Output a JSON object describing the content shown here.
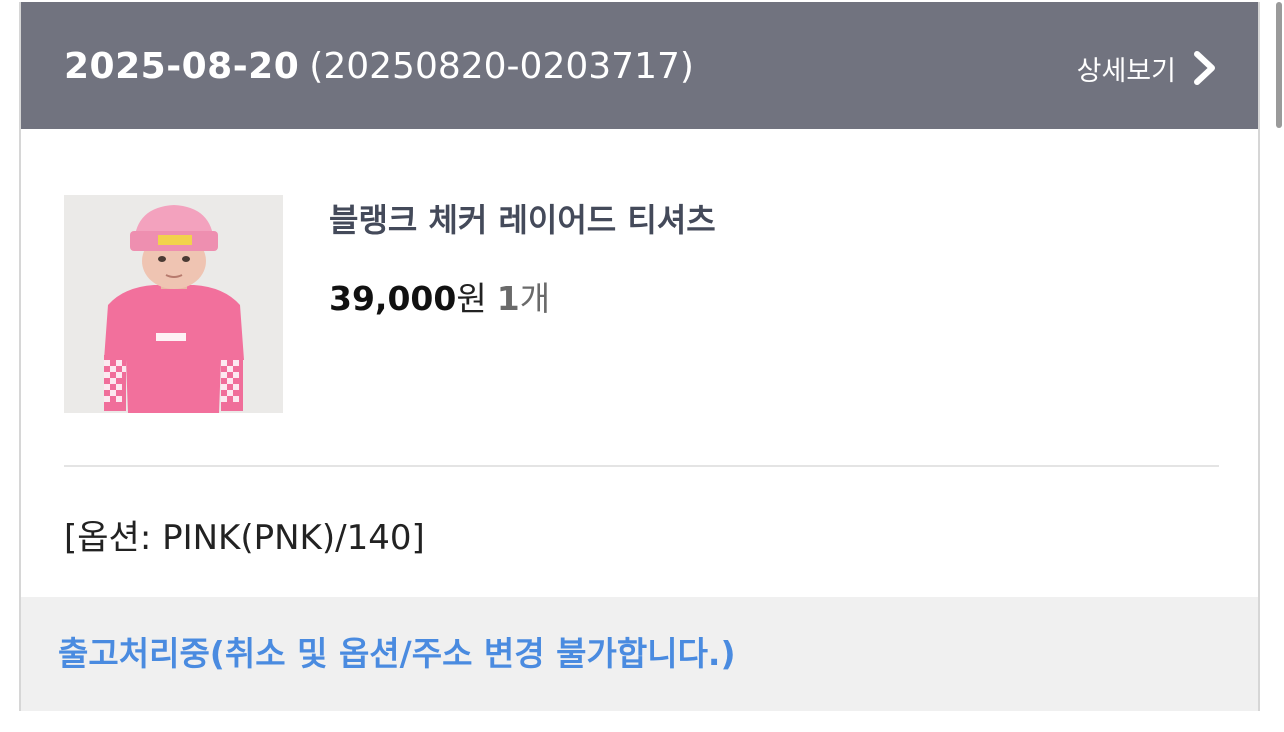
{
  "order": {
    "date": "2025-08-20",
    "number": "(20250820-0203717)",
    "detail_label": "상세보기",
    "detail_icon": "chevron-right-icon"
  },
  "product": {
    "name": "블랭크 체커 레이어드 티셔츠",
    "price": "39,000",
    "price_unit": "원",
    "quantity": "1",
    "quantity_unit": "개",
    "image_icon": "product-photo"
  },
  "option": {
    "text": "[옵션: PINK(PNK)/140]"
  },
  "status": {
    "text": "출고처리중(취소 및 옵션/주소 변경 불가합니다.)",
    "color": "#4a8be0"
  },
  "colors": {
    "header_bg": "#71737f",
    "status_bg": "#f0f0f0"
  }
}
